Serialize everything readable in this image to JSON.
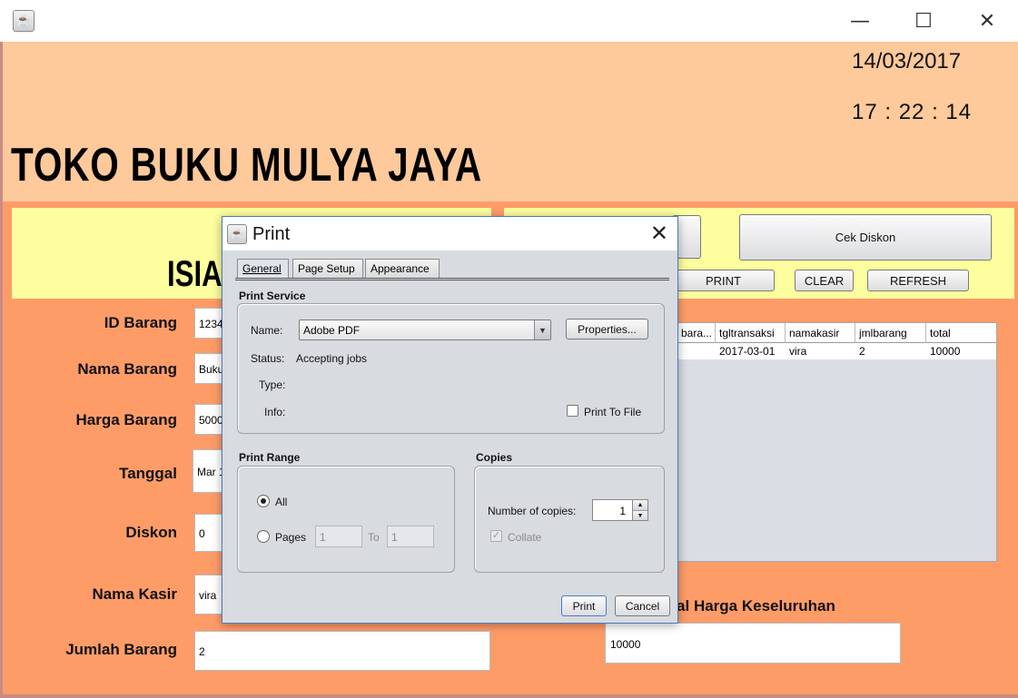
{
  "window": {
    "minimize_glyph": "—",
    "maximize_glyph": "☐",
    "close_glyph": "✕"
  },
  "header": {
    "date": "14/03/2017",
    "time": "17 : 22 : 14",
    "store_name": "TOKO BUKU MULYA JAYA"
  },
  "form": {
    "section_title": "ISIAN",
    "fields": [
      {
        "label": "ID Barang",
        "value": "1234"
      },
      {
        "label": "Nama Barang",
        "value": "Buku"
      },
      {
        "label": "Harga Barang",
        "value": "5000"
      },
      {
        "label": "Tanggal",
        "value": "Mar 1"
      },
      {
        "label": "Diskon",
        "value": "0"
      },
      {
        "label": "Nama Kasir",
        "value": "vira"
      },
      {
        "label": "Jumlah Barang",
        "value": "2"
      }
    ]
  },
  "actions": {
    "cek_diskon": "Cek Diskon",
    "print": "PRINT",
    "clear": "CLEAR",
    "refresh": "REFRESH"
  },
  "table": {
    "columns": [
      "bara...",
      "tgltransaksi",
      "namakasir",
      "jmlbarang",
      "total"
    ],
    "rows": [
      [
        "",
        "2017-03-01",
        "vira",
        "2",
        "10000"
      ]
    ]
  },
  "total": {
    "label": "Total Harga Keseluruhan",
    "label_visible": "otal Harga Keseluruhan",
    "value": "10000"
  },
  "print_dialog": {
    "title": "Print",
    "tabs": [
      "General",
      "Page Setup",
      "Appearance"
    ],
    "print_service": {
      "section_title": "Print Service",
      "name_label": "Name:",
      "printer": "Adobe PDF",
      "properties_button": "Properties...",
      "status_label": "Status:",
      "status_value": "Accepting jobs",
      "type_label": "Type:",
      "info_label": "Info:",
      "print_to_file": "Print To File"
    },
    "print_range": {
      "section_title": "Print Range",
      "all": "All",
      "pages": "Pages",
      "from": "1",
      "to_label": "To",
      "to": "1"
    },
    "copies": {
      "section_title": "Copies",
      "number_label": "Number of copies:",
      "value": "1",
      "collate": "Collate"
    },
    "print_button": "Print",
    "cancel_button": "Cancel"
  }
}
